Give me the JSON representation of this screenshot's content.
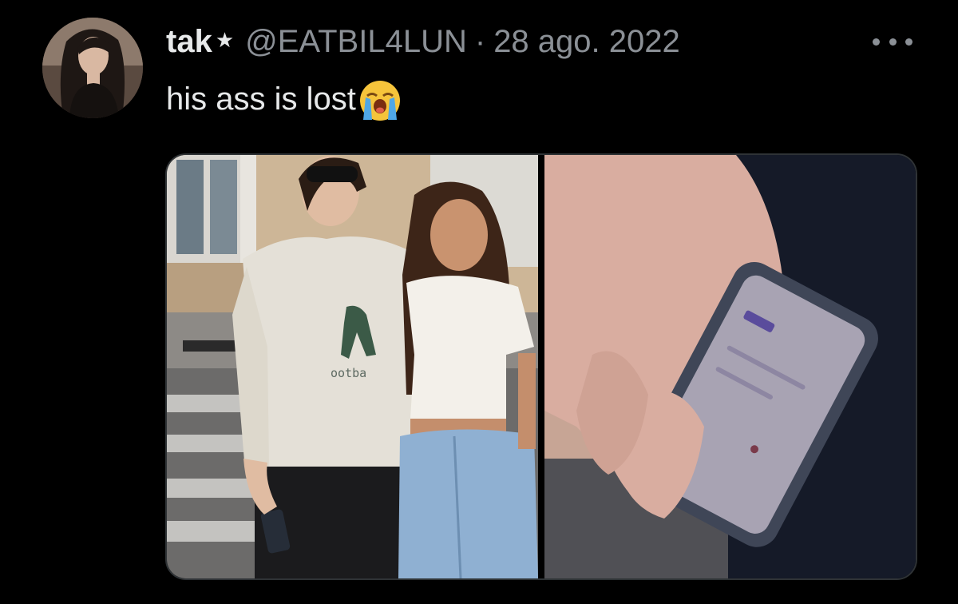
{
  "tweet": {
    "avatar_icon": "user-avatar",
    "display_name": "tak",
    "badge_glyph": "★",
    "handle": "@EATBIL4LUN",
    "separator": "·",
    "date": "28 ago. 2022",
    "text": "his ass is lost",
    "emoji_icon": "loudly-crying-face-icon",
    "more_icon": "more-horizontal-icon"
  },
  "media": {
    "photos": [
      {
        "icon": "photo-two-people-street",
        "shirt_text": "ootba"
      },
      {
        "icon": "photo-hand-holding-phone"
      }
    ]
  },
  "colors": {
    "background": "#000000",
    "primary_text": "#e7e9ea",
    "secondary_text": "#8b9096",
    "border": "#2f3336"
  }
}
